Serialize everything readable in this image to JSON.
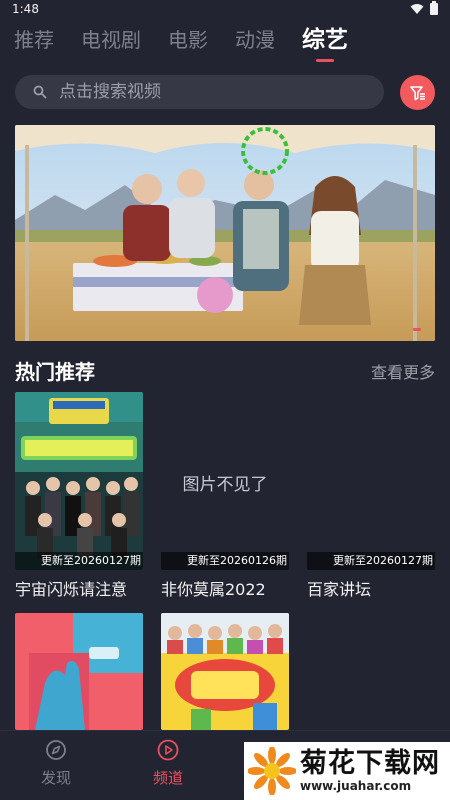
{
  "status_bar": {
    "time": "1:48"
  },
  "tabs": [
    {
      "label": "推荐",
      "active": false
    },
    {
      "label": "电视剧",
      "active": false
    },
    {
      "label": "电影",
      "active": false
    },
    {
      "label": "动漫",
      "active": false
    },
    {
      "label": "综艺",
      "active": true
    }
  ],
  "search": {
    "placeholder": "点击搜索视频"
  },
  "banner": {
    "slide_count": 1,
    "active_slide": 1
  },
  "section": {
    "title": "热门推荐",
    "see_more": "查看更多"
  },
  "cards": [
    {
      "title": "宇宙闪烁请注意",
      "update": "更新至20260127期",
      "missing": ""
    },
    {
      "title": "非你莫属2022",
      "update": "更新至20260126期",
      "missing": "图片不见了"
    },
    {
      "title": "百家讲坛",
      "update": "更新至20260127期",
      "missing": ""
    },
    {
      "title": "",
      "update": "",
      "missing": ""
    },
    {
      "title": "",
      "update": "",
      "missing": ""
    }
  ],
  "bottom_nav": [
    {
      "label": "发现",
      "icon": "compass-icon",
      "active": false
    },
    {
      "label": "频道",
      "icon": "play-icon",
      "active": true
    }
  ],
  "watermark": {
    "title": "菊花下载网",
    "url": "www.juahar.com"
  },
  "colors": {
    "background": "#232431",
    "accent": "#e8515f",
    "filter_button": "#f25a5d"
  }
}
